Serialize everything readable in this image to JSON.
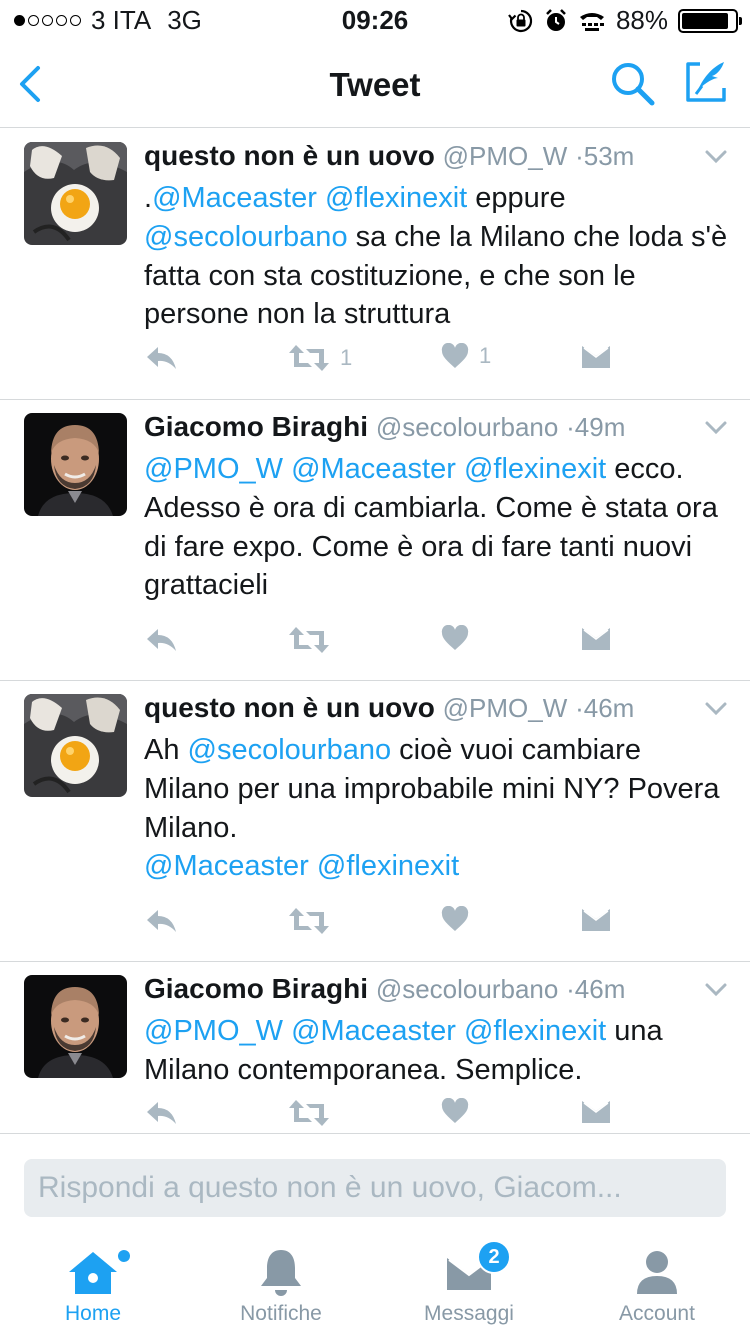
{
  "status": {
    "carrier": "3 ITA",
    "network": "3G",
    "time": "09:26",
    "battery": "88%",
    "battery_level": 0.88
  },
  "nav": {
    "title": "Tweet",
    "back_icon": "chevron-left-icon",
    "search_icon": "search-icon",
    "compose_icon": "compose-icon"
  },
  "tweets": [
    {
      "name": "questo non è un uovo",
      "handle": "@PMO_W",
      "sep": "·",
      "time": "53m",
      "avatar": "egg",
      "body": [
        {
          "t": ".",
          "m": false
        },
        {
          "t": "@Maceaster",
          "m": true
        },
        {
          "t": " ",
          "m": false
        },
        {
          "t": "@flexinexit",
          "m": true
        },
        {
          "t": " eppure ",
          "m": false
        },
        {
          "t": "@secolourbano",
          "m": true
        },
        {
          "t": " sa che la Milano che loda s'è fatta con sta costituzione, e che son le persone non la struttura",
          "m": false
        }
      ],
      "retweets": "1",
      "likes": "1"
    },
    {
      "name": "Giacomo Biraghi",
      "handle": "@secolourbano",
      "sep": "·",
      "time": "49m",
      "avatar": "man",
      "body": [
        {
          "t": "@PMO_W",
          "m": true
        },
        {
          "t": " ",
          "m": false
        },
        {
          "t": "@Maceaster",
          "m": true
        },
        {
          "t": " ",
          "m": false
        },
        {
          "t": "@flexinexit",
          "m": true
        },
        {
          "t": " ecco. Adesso è ora di cambiarla. Come è stata ora di fare expo. Come è ora di fare tanti nuovi grattacieli",
          "m": false
        }
      ],
      "retweets": "",
      "likes": ""
    },
    {
      "name": "questo non è un uovo",
      "handle": "@PMO_W",
      "sep": "·",
      "time": "46m",
      "avatar": "egg",
      "body": [
        {
          "t": "Ah ",
          "m": false
        },
        {
          "t": "@secolourbano",
          "m": true
        },
        {
          "t": " cioè vuoi cambiare Milano per una improbabile mini NY? Povera Milano.",
          "m": false
        },
        {
          "br": true
        },
        {
          "t": "@Maceaster",
          "m": true
        },
        {
          "t": " ",
          "m": false
        },
        {
          "t": "@flexinexit",
          "m": true
        }
      ],
      "retweets": "",
      "likes": ""
    },
    {
      "name": "Giacomo Biraghi",
      "handle": "@secolourbano",
      "sep": "·",
      "time": "46m",
      "avatar": "man",
      "body": [
        {
          "t": "@PMO_W",
          "m": true
        },
        {
          "t": " ",
          "m": false
        },
        {
          "t": "@Maceaster",
          "m": true
        },
        {
          "t": " ",
          "m": false
        },
        {
          "t": "@flexinexit",
          "m": true
        },
        {
          "t": " una Milano contemporanea. Semplice.",
          "m": false
        }
      ],
      "retweets": "",
      "likes": ""
    }
  ],
  "reply": {
    "placeholder": "Rispondi a questo non è un uovo, Giacom..."
  },
  "tabs": [
    {
      "label": "Home",
      "icon": "home-icon",
      "active": true
    },
    {
      "label": "Notifiche",
      "icon": "bell-icon",
      "active": false
    },
    {
      "label": "Messaggi",
      "icon": "envelope-icon",
      "active": false,
      "badge": "2"
    },
    {
      "label": "Account",
      "icon": "person-icon",
      "active": false
    }
  ],
  "colors": {
    "accent": "#1da1f2",
    "text": "#14171a",
    "muted": "#8899a6",
    "action": "#aab8c2",
    "divider": "#d6d9db"
  }
}
